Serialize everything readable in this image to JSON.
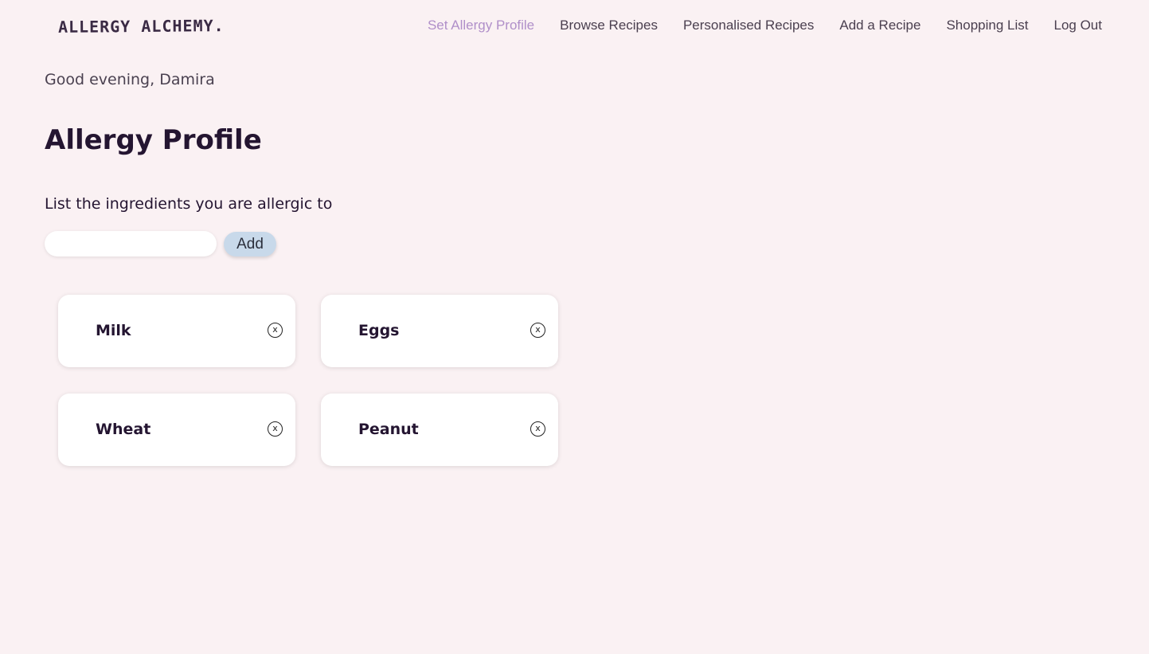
{
  "app": {
    "logo": "ALLERGY ALCHEMY."
  },
  "nav": {
    "items": [
      {
        "label": "Set Allergy Profile",
        "active": true
      },
      {
        "label": "Browse Recipes",
        "active": false
      },
      {
        "label": "Personalised Recipes",
        "active": false
      },
      {
        "label": "Add a Recipe",
        "active": false
      },
      {
        "label": "Shopping List",
        "active": false
      },
      {
        "label": "Log Out",
        "active": false
      }
    ]
  },
  "main": {
    "greeting": "Good evening, Damira",
    "title": "Allergy Profile",
    "instruction": "List the ingredients you are allergic to",
    "input": {
      "value": "",
      "placeholder": ""
    },
    "add_label": "Add",
    "allergies": [
      {
        "name": "Milk",
        "remove_glyph": "x"
      },
      {
        "name": "Eggs",
        "remove_glyph": "x"
      },
      {
        "name": "Wheat",
        "remove_glyph": "x"
      },
      {
        "name": "Peanut",
        "remove_glyph": "x"
      }
    ]
  },
  "colors": {
    "background": "#faf1f3",
    "nav_active": "#b08fc9",
    "add_button": "#c8d9ea",
    "card_background": "#ffffff"
  }
}
